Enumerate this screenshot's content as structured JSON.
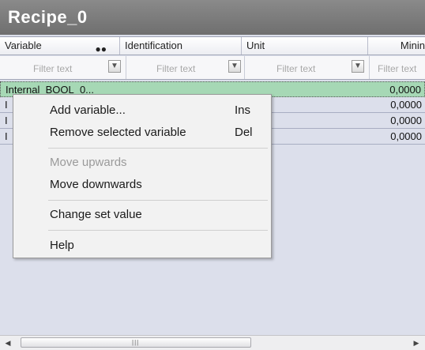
{
  "window": {
    "title": "Recipe_0"
  },
  "columns": [
    {
      "label": "Variable"
    },
    {
      "label": "Identification"
    },
    {
      "label": "Unit"
    },
    {
      "label": "Minin"
    }
  ],
  "filter": {
    "placeholder": "Filter text"
  },
  "rows": [
    {
      "name": "Internal_BOOL_0...",
      "value": "0,0000"
    },
    {
      "name": "I",
      "value": "0,0000"
    },
    {
      "name": "I",
      "value": "0,0000"
    },
    {
      "name": "I",
      "value": "0,0000"
    }
  ],
  "context_menu": {
    "items": [
      {
        "label": "Add variable...",
        "shortcut": "Ins",
        "enabled": true
      },
      {
        "label": "Remove selected variable",
        "shortcut": "Del",
        "enabled": true
      },
      {
        "label": "Move upwards",
        "enabled": false
      },
      {
        "label": "Move downwards",
        "enabled": true
      },
      {
        "label": "Change set value",
        "enabled": true
      },
      {
        "label": "Help",
        "enabled": true
      }
    ]
  },
  "icons": {
    "search": "binoculars-icon",
    "filter": "funnel-icon",
    "scroll_left": "arrow-left-icon",
    "scroll_right": "arrow-right-icon"
  },
  "colors": {
    "title_bar": "#777777",
    "selected_row": "#a6d8b5",
    "grid_background": "#dcdfeb"
  }
}
